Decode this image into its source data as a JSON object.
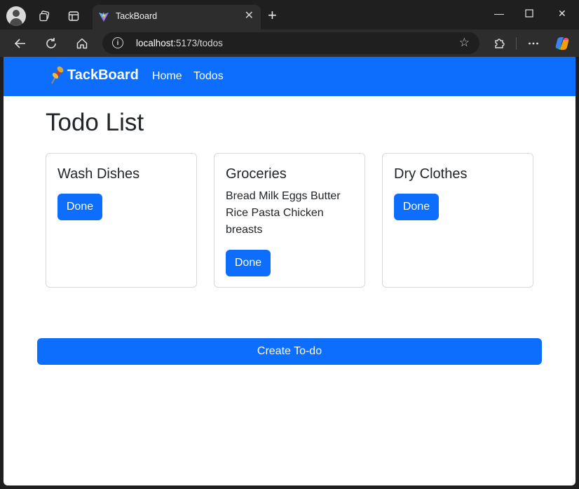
{
  "browser": {
    "tab_title": "TackBoard",
    "url_host": "localhost",
    "url_rest": ":5173/todos"
  },
  "icons": {
    "profile": "profile-icon",
    "workspaces": "workspaces-icon",
    "tab_actions": "tab-actions-icon",
    "favicon": "vite-favicon-icon",
    "back": "back-arrow-icon",
    "reload": "reload-icon",
    "home": "home-icon",
    "info": "site-info-icon",
    "favorite": "star-icon",
    "extensions": "extensions-icon",
    "more": "more-icon",
    "copilot": "copilot-icon",
    "brand": "pushpin-icon"
  },
  "app": {
    "brand": "TackBoard",
    "nav": [
      "Home",
      "Todos"
    ],
    "page_title": "Todo List",
    "todos": [
      {
        "title": "Wash Dishes",
        "description": "",
        "button": "Done"
      },
      {
        "title": "Groceries",
        "description": "Bread Milk Eggs Butter Rice Pasta Chicken breasts",
        "button": "Done"
      },
      {
        "title": "Dry Clothes",
        "description": "",
        "button": "Done"
      }
    ],
    "create_button": "Create To-do"
  },
  "colors": {
    "primary": "#0d6efd",
    "browser_chrome": "#1f1f1f",
    "toolbar": "#2d2d2d"
  }
}
